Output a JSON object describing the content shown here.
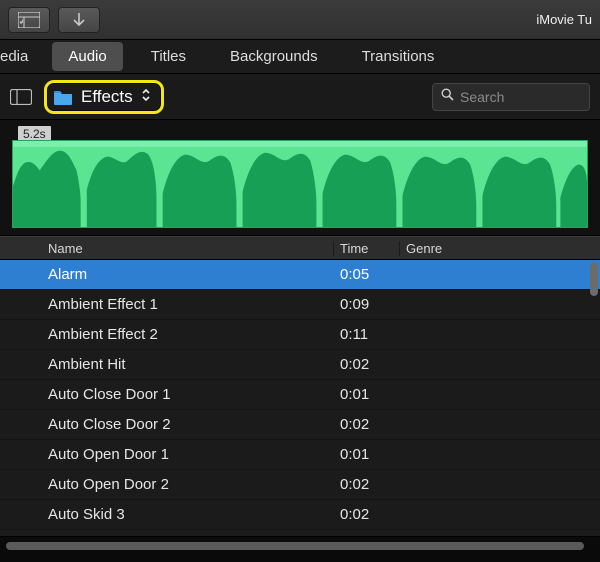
{
  "app_title": "iMovie Tu",
  "tabs": {
    "media": "edia",
    "audio": "Audio",
    "titles": "Titles",
    "backgrounds": "Backgrounds",
    "transitions": "Transitions",
    "active": "audio"
  },
  "browser": {
    "folder_label": "Effects",
    "search_placeholder": "Search"
  },
  "waveform": {
    "duration_badge": "5.2s"
  },
  "columns": {
    "name": "Name",
    "time": "Time",
    "genre": "Genre"
  },
  "rows": [
    {
      "name": "Alarm",
      "time": "0:05",
      "genre": "",
      "selected": true
    },
    {
      "name": "Ambient Effect 1",
      "time": "0:09",
      "genre": "",
      "selected": false
    },
    {
      "name": "Ambient Effect 2",
      "time": "0:11",
      "genre": "",
      "selected": false
    },
    {
      "name": "Ambient Hit",
      "time": "0:02",
      "genre": "",
      "selected": false
    },
    {
      "name": "Auto Close Door 1",
      "time": "0:01",
      "genre": "",
      "selected": false
    },
    {
      "name": "Auto Close Door 2",
      "time": "0:02",
      "genre": "",
      "selected": false
    },
    {
      "name": "Auto Open Door 1",
      "time": "0:01",
      "genre": "",
      "selected": false
    },
    {
      "name": "Auto Open Door 2",
      "time": "0:02",
      "genre": "",
      "selected": false
    },
    {
      "name": "Auto Skid 3",
      "time": "0:02",
      "genre": "",
      "selected": false
    }
  ]
}
